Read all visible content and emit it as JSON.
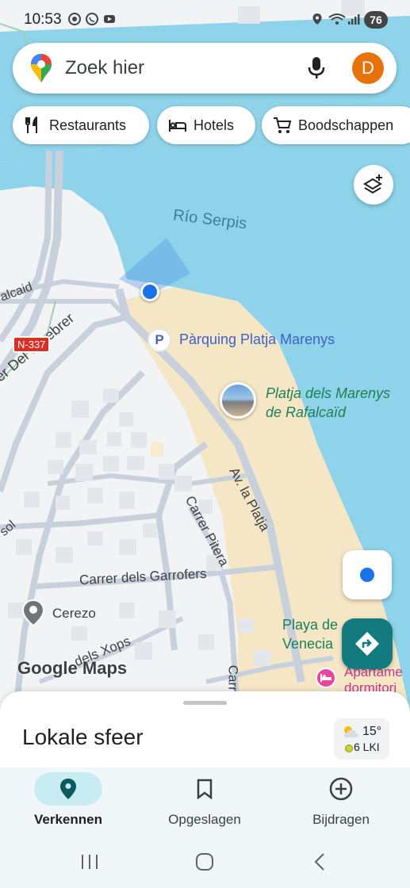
{
  "status_bar": {
    "time": "10:53",
    "battery": "76"
  },
  "search": {
    "placeholder": "Zoek hier",
    "avatar_letter": "D"
  },
  "chips": [
    {
      "label": "Restaurants",
      "icon": "fork-knife-icon"
    },
    {
      "label": "Hotels",
      "icon": "bed-icon"
    },
    {
      "label": "Boodschappen",
      "icon": "shopping-cart-icon"
    }
  ],
  "map": {
    "labels": {
      "river": "Río Serpis",
      "parking": "Pàrquing Platja Marenys",
      "beach_line1": "Platja dels Marenys",
      "beach_line2": "de Rafalcaïd",
      "street_ginebrer": "er Del Ginebrer",
      "road_badge": "N-337",
      "rafalcaid_left": "alcaid",
      "av_platja": "Av. la Platja",
      "carrer_pitera": "Carrer Pitera",
      "garrofers": "Carrer dels Garrofers",
      "cerezo": "Cerezo",
      "xops": "dels Xops",
      "playa_venecia_line1": "Playa de",
      "playa_venecia_line2": "Venecia",
      "apartment_line1": "Apartame",
      "apartment_line2": "dormitori",
      "carrer_bottom": "Carre",
      "sol": "sol",
      "google_maps_logo": "Google Maps"
    },
    "colors": {
      "water": "#8fd3ea",
      "beach": "#f5e7c6",
      "land": "#f1f3f4",
      "road": "#c8d0dc",
      "label_water": "#3b7fa0",
      "label_poi_green": "#1e7e57",
      "label_poi_blue": "#3b62c8",
      "location_blue": "#1a73e8"
    }
  },
  "bottom_sheet": {
    "title": "Lokale sfeer",
    "temperature": "15°",
    "aqi": "6 LKI"
  },
  "bottom_nav": [
    {
      "label": "Verkennen",
      "icon": "location-pin-icon",
      "active": true
    },
    {
      "label": "Opgeslagen",
      "icon": "bookmark-icon",
      "active": false
    },
    {
      "label": "Bijdragen",
      "icon": "add-circle-icon",
      "active": false
    }
  ]
}
